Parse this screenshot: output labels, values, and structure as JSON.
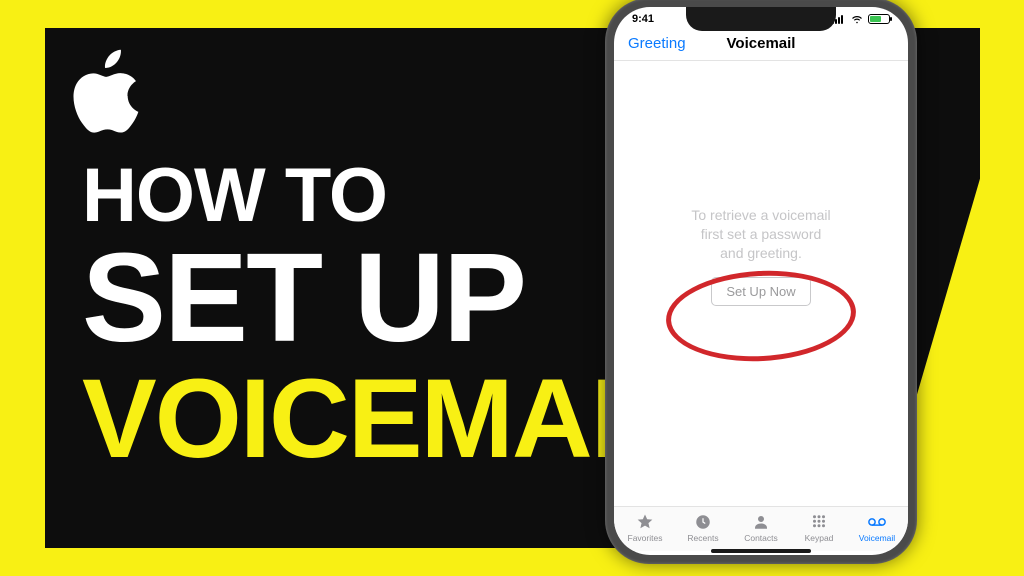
{
  "title": {
    "line1": "HOW TO",
    "line2": "SET UP",
    "line3": "VOICEMAIL"
  },
  "statusbar": {
    "time": "9:41"
  },
  "nav": {
    "back": "Greeting",
    "title": "Voicemail"
  },
  "body": {
    "message_l1": "To retrieve a voicemail",
    "message_l2": "first set a password",
    "message_l3": "and greeting.",
    "button": "Set Up Now"
  },
  "tabs": {
    "favorites": "Favorites",
    "recents": "Recents",
    "contacts": "Contacts",
    "keypad": "Keypad",
    "voicemail": "Voicemail"
  }
}
